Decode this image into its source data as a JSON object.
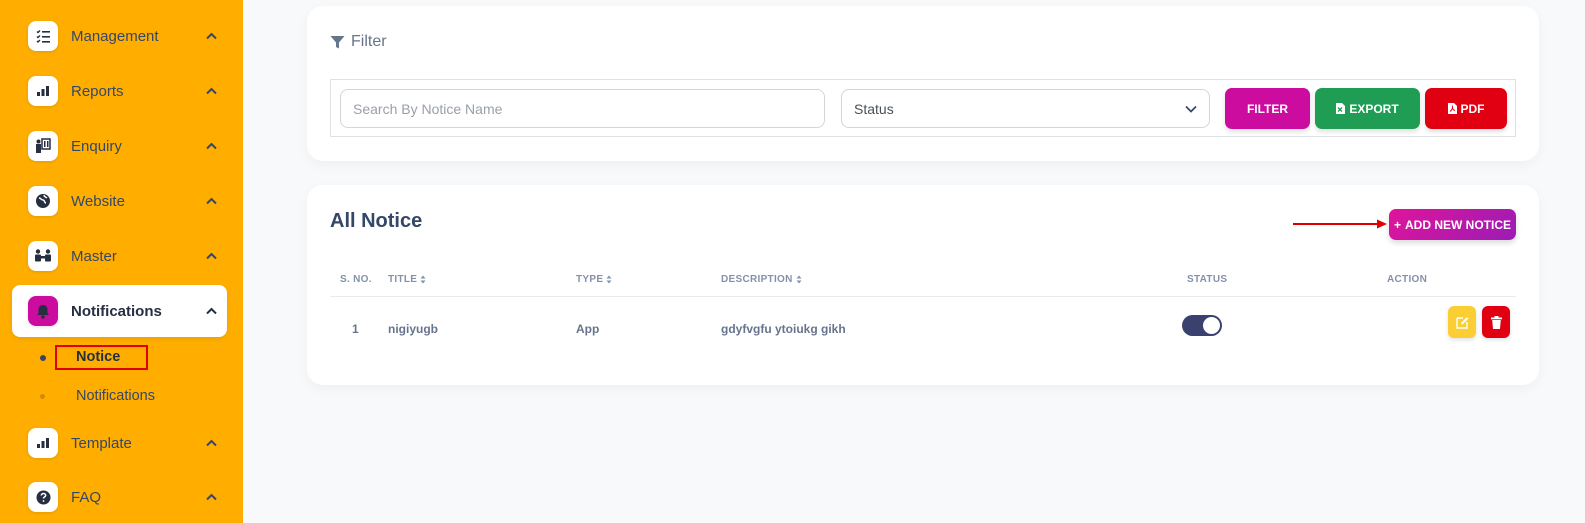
{
  "sidebar": {
    "items": [
      {
        "label": "Management",
        "icon": "list-check-icon"
      },
      {
        "label": "Reports",
        "icon": "bar-chart-icon"
      },
      {
        "label": "Enquiry",
        "icon": "people-board-icon"
      },
      {
        "label": "Website",
        "icon": "earth-icon"
      },
      {
        "label": "Master",
        "icon": "group-icon"
      },
      {
        "label": "Notifications",
        "icon": "bell-icon"
      },
      {
        "label": "Template",
        "icon": "bar-chart-icon"
      },
      {
        "label": "FAQ",
        "icon": "question-circle-icon"
      }
    ],
    "sub_items": [
      {
        "label": "Notice"
      },
      {
        "label": "Notifications"
      }
    ]
  },
  "filter": {
    "title": "Filter",
    "search_placeholder": "Search By Notice Name",
    "status_value": "Status",
    "filter_label": "FILTER",
    "export_label": "EXPORT",
    "pdf_label": "PDF"
  },
  "notice_list": {
    "title": "All Notice",
    "add_label": "ADD NEW NOTICE",
    "add_prefix": "+",
    "columns": {
      "sno": "S. NO.",
      "title": "TITLE",
      "type": "TYPE",
      "description": "DESCRIPTION",
      "status": "STATUS",
      "action": "ACTION"
    },
    "rows": [
      {
        "sno": "1",
        "title": "nigiyugb",
        "type": "App",
        "description": "gdyfvgfu ytoiukg gikh",
        "status_on": true
      }
    ]
  },
  "colors": {
    "sidebar_bg": "#ffae00",
    "accent": "#cb0c9f",
    "export": "#1f9d55",
    "pdf": "#e00012",
    "edit": "#fbcf33",
    "annotation": "#e00000"
  }
}
